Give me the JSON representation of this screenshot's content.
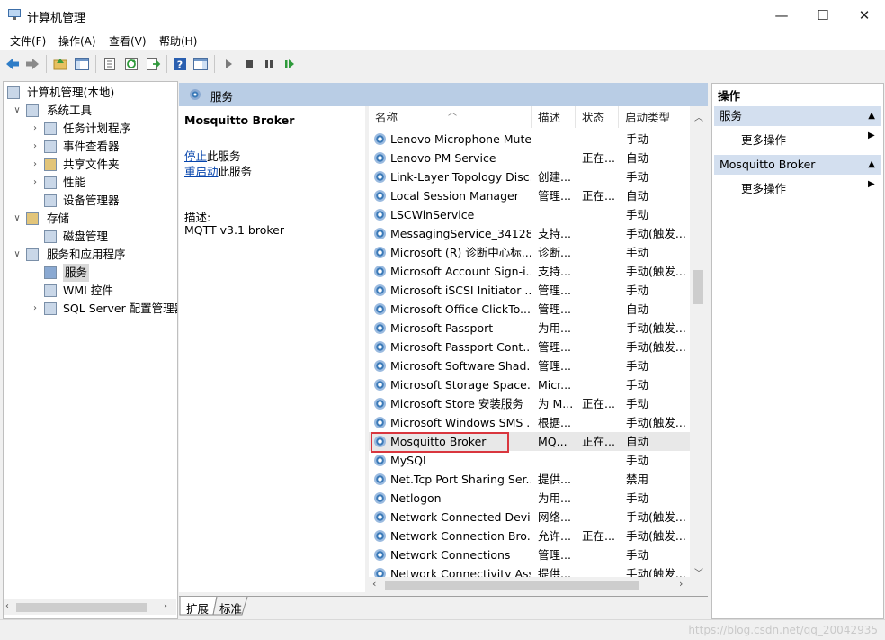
{
  "window": {
    "title": "计算机管理",
    "controls": {
      "minimize": "—",
      "maximize": "☐",
      "close": "✕"
    }
  },
  "menu": [
    "文件(F)",
    "操作(A)",
    "查看(V)",
    "帮助(H)"
  ],
  "tree": [
    {
      "label": "计算机管理(本地)",
      "icon": "computer-management-icon",
      "level": 0,
      "expander": ""
    },
    {
      "label": "系统工具",
      "icon": "system-tools-icon",
      "level": 1,
      "expander": "∨"
    },
    {
      "label": "任务计划程序",
      "icon": "task-scheduler-icon",
      "level": 2,
      "expander": "›"
    },
    {
      "label": "事件查看器",
      "icon": "event-viewer-icon",
      "level": 2,
      "expander": "›"
    },
    {
      "label": "共享文件夹",
      "icon": "shared-folders-icon",
      "level": 2,
      "expander": "›"
    },
    {
      "label": "性能",
      "icon": "performance-icon",
      "level": 2,
      "expander": "›"
    },
    {
      "label": "设备管理器",
      "icon": "device-manager-icon",
      "level": 2,
      "expander": ""
    },
    {
      "label": "存储",
      "icon": "storage-icon",
      "level": 1,
      "expander": "∨"
    },
    {
      "label": "磁盘管理",
      "icon": "disk-management-icon",
      "level": 2,
      "expander": ""
    },
    {
      "label": "服务和应用程序",
      "icon": "services-apps-icon",
      "level": 1,
      "expander": "∨"
    },
    {
      "label": "服务",
      "icon": "services-icon",
      "level": 2,
      "expander": "",
      "selected": true
    },
    {
      "label": "WMI 控件",
      "icon": "wmi-icon",
      "level": 2,
      "expander": ""
    },
    {
      "label": "SQL Server 配置管理器",
      "icon": "sql-server-icon",
      "level": 2,
      "expander": "›"
    }
  ],
  "center": {
    "header": "服务",
    "selected_title": "Mosquitto Broker",
    "stop_link": "停止",
    "stop_suffix": "此服务",
    "restart_link": "重启动",
    "restart_suffix": "此服务",
    "desc_label": "描述:",
    "desc_text": "MQTT v3.1 broker"
  },
  "columns": [
    "名称",
    "描述",
    "状态",
    "启动类型"
  ],
  "services": [
    {
      "name": "Lenovo Microphone Mute",
      "desc": "",
      "status": "",
      "startup": "手动"
    },
    {
      "name": "Lenovo PM Service",
      "desc": "",
      "status": "正在...",
      "startup": "自动"
    },
    {
      "name": "Link-Layer Topology Disc...",
      "desc": "创建...",
      "status": "",
      "startup": "手动"
    },
    {
      "name": "Local Session Manager",
      "desc": "管理...",
      "status": "正在...",
      "startup": "自动"
    },
    {
      "name": "LSCWinService",
      "desc": "",
      "status": "",
      "startup": "手动"
    },
    {
      "name": "MessagingService_34128",
      "desc": "支持...",
      "status": "",
      "startup": "手动(触发..."
    },
    {
      "name": "Microsoft (R) 诊断中心标...",
      "desc": "诊断...",
      "status": "",
      "startup": "手动"
    },
    {
      "name": "Microsoft Account Sign-i...",
      "desc": "支持...",
      "status": "",
      "startup": "手动(触发..."
    },
    {
      "name": "Microsoft iSCSI Initiator ...",
      "desc": "管理...",
      "status": "",
      "startup": "手动"
    },
    {
      "name": "Microsoft Office ClickTo...",
      "desc": "管理...",
      "status": "",
      "startup": "自动"
    },
    {
      "name": "Microsoft Passport",
      "desc": "为用...",
      "status": "",
      "startup": "手动(触发..."
    },
    {
      "name": "Microsoft Passport Cont...",
      "desc": "管理...",
      "status": "",
      "startup": "手动(触发..."
    },
    {
      "name": "Microsoft Software Shad...",
      "desc": "管理...",
      "status": "",
      "startup": "手动"
    },
    {
      "name": "Microsoft Storage Space...",
      "desc": "Micr...",
      "status": "",
      "startup": "手动"
    },
    {
      "name": "Microsoft Store 安装服务",
      "desc": "为 M...",
      "status": "正在...",
      "startup": "手动"
    },
    {
      "name": "Microsoft Windows SMS ...",
      "desc": "根据...",
      "status": "",
      "startup": "手动(触发..."
    },
    {
      "name": "Mosquitto Broker",
      "desc": "MQ...",
      "status": "正在...",
      "startup": "自动",
      "selected": true
    },
    {
      "name": "MySQL",
      "desc": "",
      "status": "",
      "startup": "手动"
    },
    {
      "name": "Net.Tcp Port Sharing Ser...",
      "desc": "提供...",
      "status": "",
      "startup": "禁用"
    },
    {
      "name": "Netlogon",
      "desc": "为用...",
      "status": "",
      "startup": "手动"
    },
    {
      "name": "Network Connected Devi...",
      "desc": "网络...",
      "status": "",
      "startup": "手动(触发..."
    },
    {
      "name": "Network Connection Bro...",
      "desc": "允许...",
      "status": "正在...",
      "startup": "手动(触发..."
    },
    {
      "name": "Network Connections",
      "desc": "管理...",
      "status": "",
      "startup": "手动"
    },
    {
      "name": "Network Connectivity Ass...",
      "desc": "提供...",
      "status": "",
      "startup": "手动(触发..."
    }
  ],
  "tabs": [
    "扩展",
    "标准"
  ],
  "actions": {
    "title": "操作",
    "sections": [
      {
        "header": "服务",
        "item": "更多操作"
      },
      {
        "header": "Mosquitto Broker",
        "item": "更多操作"
      }
    ]
  },
  "watermark": "https://blog.csdn.net/qq_20042935"
}
